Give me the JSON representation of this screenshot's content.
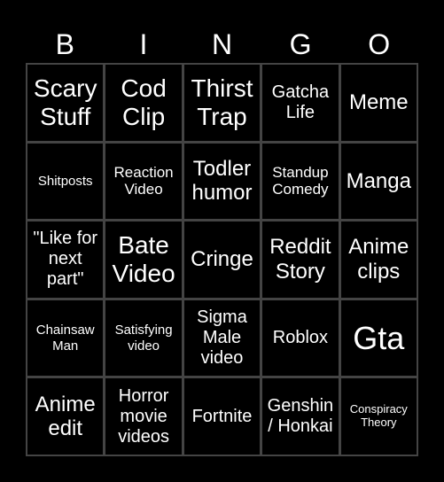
{
  "header": {
    "letters": [
      "B",
      "I",
      "N",
      "G",
      "O"
    ]
  },
  "board": {
    "rows": [
      [
        "Scary Stuff",
        "Cod Clip",
        "Thirst Trap",
        "Gatcha Life",
        "Meme"
      ],
      [
        "Shitposts",
        "Reaction Video",
        "Todler humor",
        "Standup Comedy",
        "Manga"
      ],
      [
        "\"Like for next part\"",
        "Bate Video",
        "Cringe",
        "Reddit Story",
        "Anime clips"
      ],
      [
        "Chainsaw Man",
        "Satisfying video",
        "Sigma Male video",
        "Roblox",
        "Gta"
      ],
      [
        "Anime edit",
        "Horror movie videos",
        "Fortnite",
        "Genshin / Honkai",
        "Conspiracy Theory"
      ]
    ]
  },
  "colors": {
    "background": "#000000",
    "grid_line": "#444444",
    "text": "#ffffff"
  }
}
